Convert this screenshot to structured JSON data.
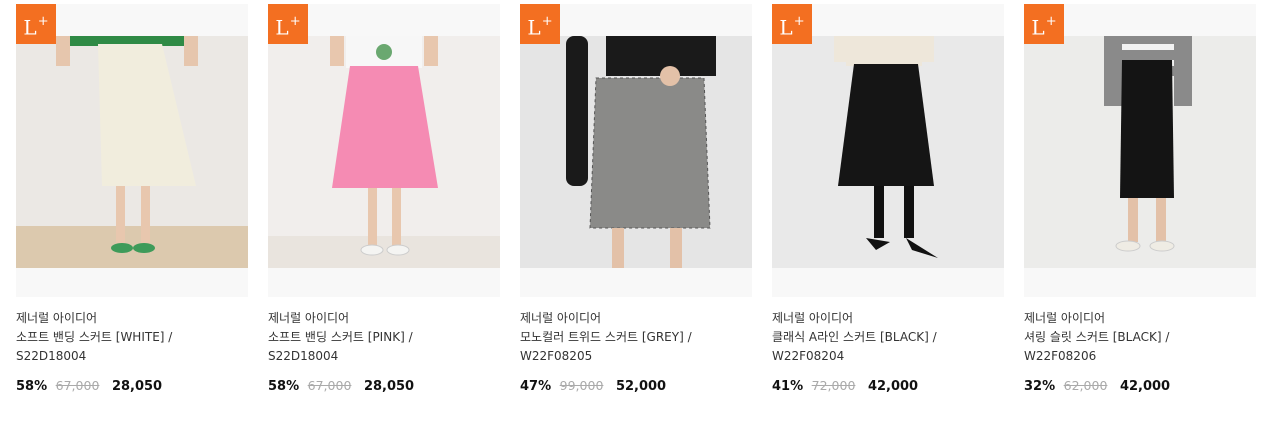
{
  "badge": {
    "text": "L",
    "plus": "+"
  },
  "products": [
    {
      "brand": "제너럴 아이디어",
      "name_line1": "소프트 밴딩 스커트 [WHITE] /",
      "name_line2": "S22D18004",
      "discount": "58%",
      "original_price": "67,000",
      "sale_price": "28,050",
      "skirt_color": "#f1eddd",
      "shoe_color": "#3e9b5a",
      "top_color": "#2f8a45"
    },
    {
      "brand": "제너럴 아이디어",
      "name_line1": "소프트 밴딩 스커트 [PINK] /",
      "name_line2": "S22D18004",
      "discount": "58%",
      "original_price": "67,000",
      "sale_price": "28,050",
      "skirt_color": "#f58bb3",
      "shoe_color": "#f4f4f2",
      "top_color": "#f7f7f7"
    },
    {
      "brand": "제너럴 아이디어",
      "name_line1": "모노컬러 트위드 스커트 [GREY] /",
      "name_line2": "W22F08205",
      "discount": "47%",
      "original_price": "99,000",
      "sale_price": "52,000",
      "skirt_color": "#8a8a88",
      "shoe_color": "#222222",
      "top_color": "#1a1a1a"
    },
    {
      "brand": "제너럴 아이디어",
      "name_line1": "클래식 A라인 스커트 [BLACK] /",
      "name_line2": "W22F08204",
      "discount": "41%",
      "original_price": "72,000",
      "sale_price": "42,000",
      "skirt_color": "#151515",
      "shoe_color": "#111111",
      "top_color": "#eee7da"
    },
    {
      "brand": "제너럴 아이디어",
      "name_line1": "셔링 슬릿 스커트 [BLACK] /",
      "name_line2": "W22F08206",
      "discount": "32%",
      "original_price": "62,000",
      "sale_price": "42,000",
      "skirt_color": "#141414",
      "shoe_color": "#efece4",
      "top_color": "#8a8a8a"
    }
  ]
}
